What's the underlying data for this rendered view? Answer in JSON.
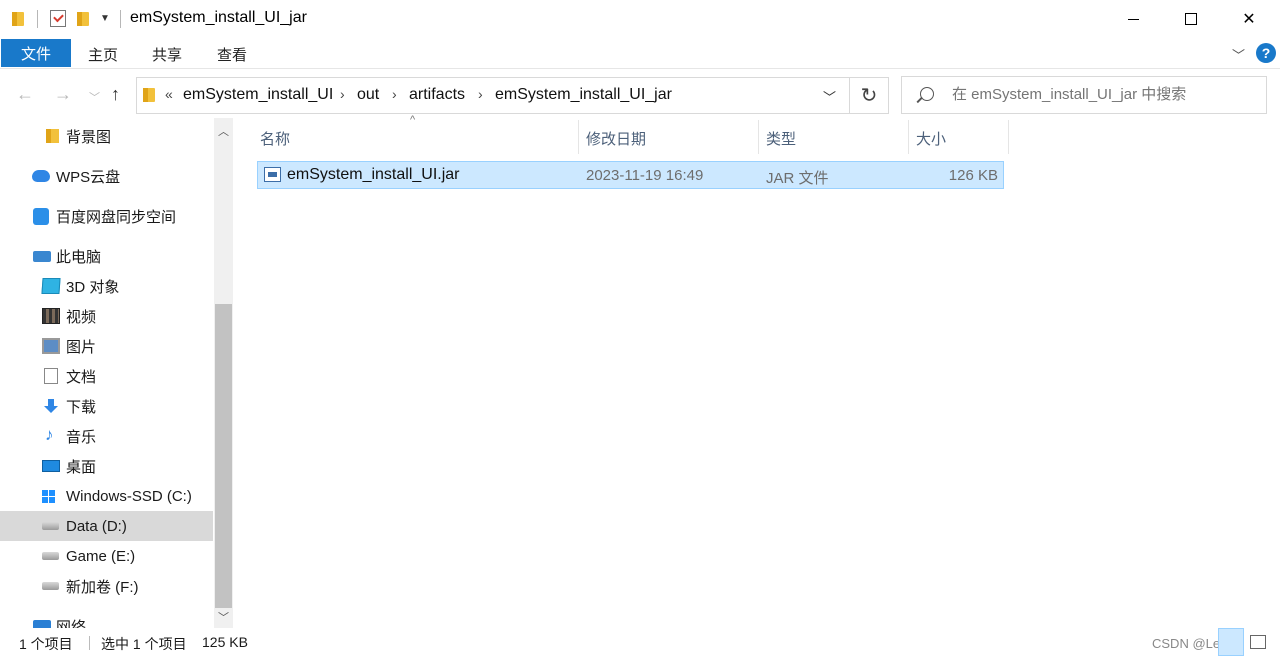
{
  "window": {
    "title": "emSystem_install_UI_jar"
  },
  "ribbon": {
    "tabs": [
      "文件",
      "主页",
      "共享",
      "查看"
    ]
  },
  "address": {
    "crumbs": [
      "emSystem_install_UI",
      "out",
      "artifacts",
      "emSystem_install_UI_jar"
    ],
    "overflow_symbol": "«"
  },
  "search": {
    "placeholder": "在 emSystem_install_UI_jar 中搜索"
  },
  "navpane": {
    "items": [
      {
        "label": "背景图",
        "icon": "folder-icon"
      },
      {
        "label": "WPS云盘",
        "icon": "cloud-icon"
      },
      {
        "label": "百度网盘同步空间",
        "icon": "baidu-netdisk-icon"
      },
      {
        "label": "此电脑",
        "icon": "computer-icon"
      },
      {
        "label": "3D 对象",
        "icon": "3d-objects-icon"
      },
      {
        "label": "视频",
        "icon": "video-icon"
      },
      {
        "label": "图片",
        "icon": "pictures-icon"
      },
      {
        "label": "文档",
        "icon": "documents-icon"
      },
      {
        "label": "下载",
        "icon": "download-icon"
      },
      {
        "label": "音乐",
        "icon": "music-icon"
      },
      {
        "label": "桌面",
        "icon": "desktop-icon"
      },
      {
        "label": "Windows-SSD (C:)",
        "icon": "windows-drive-icon"
      },
      {
        "label": "Data (D:)",
        "icon": "drive-icon",
        "selected": true
      },
      {
        "label": "Game (E:)",
        "icon": "drive-icon"
      },
      {
        "label": "新加卷 (F:)",
        "icon": "drive-icon"
      },
      {
        "label": "网络",
        "icon": "network-icon"
      }
    ]
  },
  "filelist": {
    "columns": [
      "名称",
      "修改日期",
      "类型",
      "大小"
    ],
    "rows": [
      {
        "name": "emSystem_install_UI.jar",
        "modified": "2023-11-19 16:49",
        "type": "JAR 文件",
        "size": "126 KB",
        "selected": true
      }
    ]
  },
  "status": {
    "item_count": "1 个项目",
    "selection": "选中 1 个项目",
    "selection_size": "125 KB",
    "watermark": "CSDN @Le"
  },
  "colors": {
    "accent": "#1979ca",
    "selection_bg": "#cce8ff",
    "selection_border": "#99d1ff",
    "folder": "#f2c13b"
  }
}
